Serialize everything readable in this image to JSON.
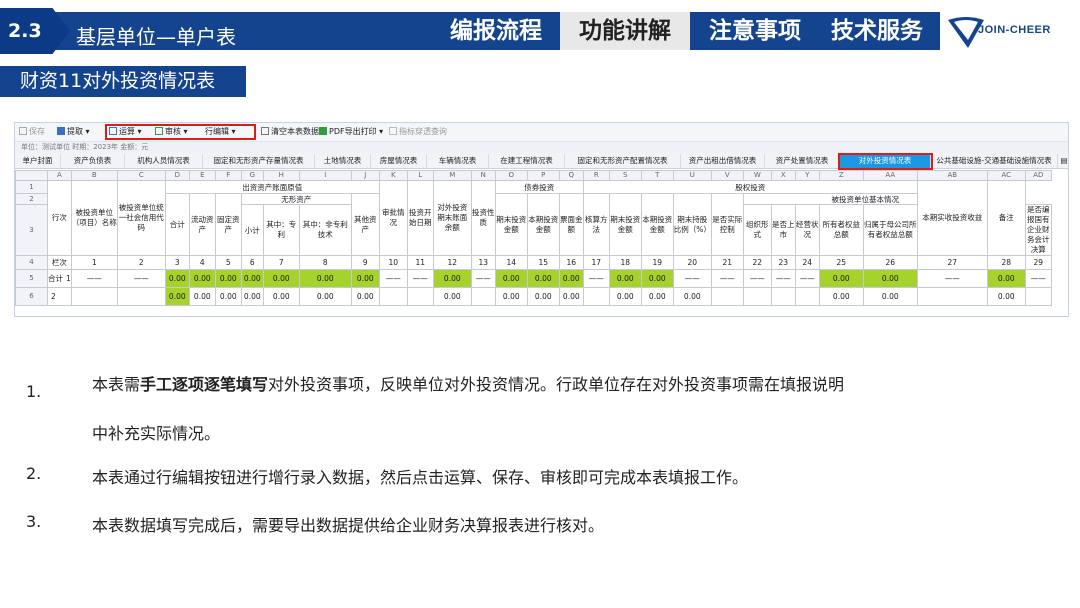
{
  "header": {
    "section_number": "2.3",
    "section_title": "基层单位—单户表",
    "nav": [
      "编报流程",
      "功能讲解",
      "注意事项",
      "技术服务"
    ],
    "active_nav": "功能讲解",
    "logo_text": "JOIN-CHEER"
  },
  "subtitle": "财资11对外投资情况表",
  "toolbar": {
    "save": "保存",
    "extract": "提取",
    "calculate": "运算",
    "audit": "审核",
    "row_edit": "行编辑",
    "clear": "清空本表数据",
    "pdf": "PDF导出打印",
    "indicator": "指标穿透查询"
  },
  "info_bar": "单位：测试单位 时期：2023年 金额：元",
  "tabs": [
    "单户封面",
    "资产负债表",
    "机构人员情况表",
    "固定和无形资产存量情况表",
    "土地情况表",
    "房屋情况表",
    "车辆情况表",
    "在建工程情况表",
    "固定和无形资产配置情况表",
    "资产出租出借情况表",
    "资产处置情况表",
    "对外投资情况表",
    "公共基础设施-交通基础设施情况表"
  ],
  "active_tab": "对外投资情况表",
  "sheet": {
    "col_letters": [
      "A",
      "B",
      "C",
      "D",
      "E",
      "F",
      "G",
      "H",
      "I",
      "J",
      "K",
      "L",
      "M",
      "N",
      "O",
      "P",
      "Q",
      "R",
      "S",
      "T",
      "U",
      "V",
      "W",
      "X",
      "Y",
      "Z",
      "AA",
      "AB",
      "AC",
      "AD",
      "AE"
    ],
    "row_nums": [
      "1",
      "2",
      "3",
      "4",
      "5",
      "6"
    ],
    "groups": {
      "book_value": "出资资产账面原值",
      "intangible": "无形资产",
      "debt": "债券投资",
      "equity": "股权投资",
      "invested_unit": "被投资单位基本情况"
    },
    "headers": {
      "row_no": "行次",
      "name": "被投资单位（项目）名称",
      "credit_code": "被投资单位统一社会信用代码",
      "total": "合计",
      "current": "流动资产",
      "fixed": "固定资产",
      "subtotal": "小计",
      "patent": "其中：专利",
      "nonpatent": "其中：非专利技术",
      "other": "其他资产",
      "approval": "审批情况",
      "start_date": "投资开始日期",
      "year_end_book": "对外投资期末账面余额",
      "nature": "投资性质",
      "debt_end": "期末投资金额",
      "debt_current": "本期投资金额",
      "debt_coupon": "票面金额",
      "accounting": "核算方法",
      "eq_end": "期末投资金额",
      "eq_current": "本期投资金额",
      "share_pct": "期末持股比例（%）",
      "control": "是否实际控制",
      "org_form": "组织形式",
      "listed": "是否上市",
      "operation": "经营状况",
      "owner_equity": "所有者权益总额",
      "parent_equity": "归属于母公司所有者权益总额",
      "consolidated": "是否编报国有企业财务会计决算",
      "income": "本期实收投资收益",
      "remark": "备注"
    },
    "row_label_hdr": "栏次",
    "col_numbers": [
      "1",
      "2",
      "3",
      "4",
      "5",
      "6",
      "7",
      "8",
      "9",
      "10",
      "11",
      "12",
      "13",
      "14",
      "15",
      "16",
      "17",
      "18",
      "19",
      "20",
      "21",
      "22",
      "23",
      "24",
      "25",
      "26",
      "27",
      "28",
      "29"
    ],
    "rows": [
      {
        "label": "合计",
        "seq": "1",
        "cells": [
          "——",
          "——",
          "0.00",
          "0.00",
          "0.00",
          "0.00",
          "0.00",
          "0.00",
          "0.00",
          "——",
          "——",
          "0.00",
          "——",
          "0.00",
          "0.00",
          "0.00",
          "——",
          "0.00",
          "0.00",
          "——",
          "——",
          "——",
          "——",
          "——",
          "0.00",
          "0.00",
          "——",
          "0.00",
          "——"
        ]
      },
      {
        "label": "",
        "seq": "2",
        "cells": [
          "",
          "",
          "0.00",
          "0.00",
          "0.00",
          "0.00",
          "0.00",
          "0.00",
          "0.00",
          "",
          "",
          "0.00",
          "",
          "0.00",
          "0.00",
          "0.00",
          "",
          "0.00",
          "0.00",
          "0.00",
          "",
          "",
          "",
          "",
          "0.00",
          "0.00",
          "",
          "0.00",
          ""
        ]
      }
    ]
  },
  "notes": [
    {
      "num": "1.",
      "before": "本表需",
      "bold": "手工逐项逐笔填写",
      "after": "对外投资事项，反映单位对外投资情况。行政单位存在对外投资事项需在填报说明",
      "line2": "中补充实际情况。"
    },
    {
      "num": "2.",
      "text": "本表通过行编辑按钮进行增行录入数据，然后点击运算、保存、审核即可完成本表填报工作。"
    },
    {
      "num": "3.",
      "text": "本表数据填写完成后，需要导出数据提供给企业财务决算报表进行核对。"
    }
  ]
}
